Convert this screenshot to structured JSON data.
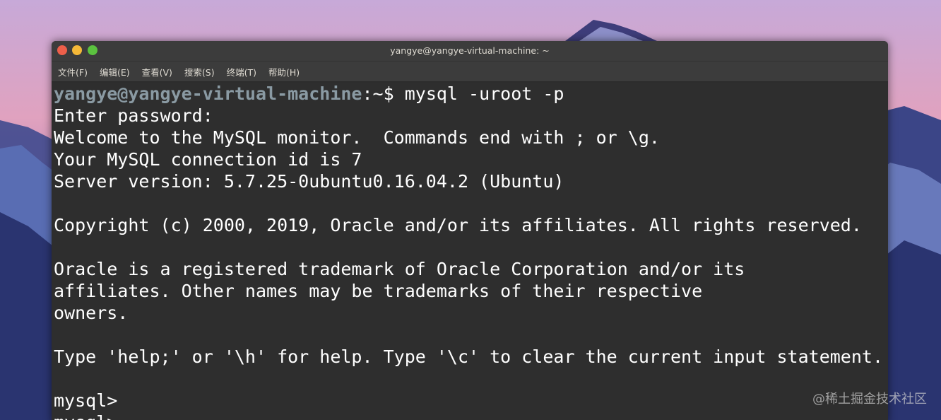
{
  "window": {
    "title": "yangye@yangye-virtual-machine: ~"
  },
  "menu": {
    "items": [
      "文件(F)",
      "编辑(E)",
      "查看(V)",
      "搜索(S)",
      "终端(T)",
      "帮助(H)"
    ]
  },
  "terminal": {
    "prompt_user": "yangye@yangye-virtual-machine",
    "prompt_path": ":~$ ",
    "command": "mysql -uroot -p",
    "lines": [
      "Enter password:",
      "Welcome to the MySQL monitor.  Commands end with ; or \\g.",
      "Your MySQL connection id is 7",
      "Server version: 5.7.25-0ubuntu0.16.04.2 (Ubuntu)",
      "",
      "Copyright (c) 2000, 2019, Oracle and/or its affiliates. All rights reserved.",
      "",
      "Oracle is a registered trademark of Oracle Corporation and/or its",
      "affiliates. Other names may be trademarks of their respective",
      "owners.",
      "",
      "Type 'help;' or '\\h' for help. Type '\\c' to clear the current input statement.",
      "",
      "mysql>",
      "mysql>"
    ]
  },
  "watermark": "@稀土掘金技术社区",
  "colors": {
    "terminal_bg": "#2e2e2e",
    "titlebar_bg": "#3c3c3c",
    "prompt_user": "#8a9aa3",
    "close": "#ed5f4a",
    "minimize": "#f4b838",
    "maximize": "#5bc23f"
  }
}
